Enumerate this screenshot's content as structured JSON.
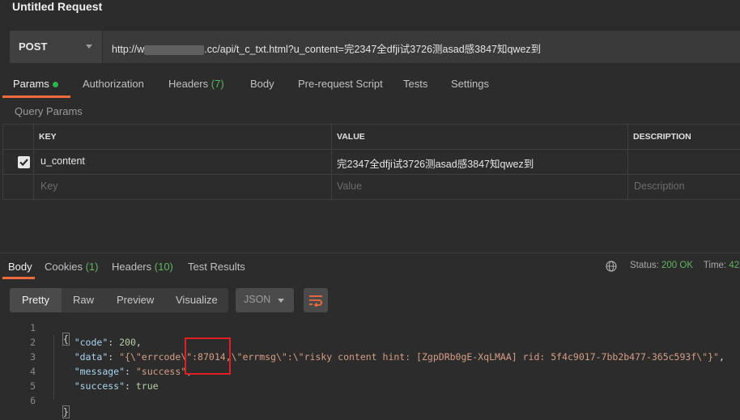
{
  "window": {
    "title": "Untitled Request"
  },
  "request": {
    "method": "POST",
    "url_prefix": "http://w",
    "url_suffix": ".cc/api/t_c_txt.html?u_content=完2347全dfji试3726测asad感3847知qwez到"
  },
  "tabs": {
    "params": "Params",
    "authorization": "Authorization",
    "headers": "Headers",
    "headers_count": "(7)",
    "body": "Body",
    "prerequest": "Pre-request Script",
    "tests": "Tests",
    "settings": "Settings"
  },
  "query_params": {
    "section_label": "Query Params",
    "columns": {
      "key": "KEY",
      "value": "VALUE",
      "description": "DESCRIPTION"
    },
    "rows": [
      {
        "checked": true,
        "key": "u_content",
        "value": "完2347全dfji试3726测asad感3847知qwez到",
        "description": ""
      }
    ],
    "placeholders": {
      "key": "Key",
      "value": "Value",
      "description": "Description"
    }
  },
  "response": {
    "tabs": {
      "body": "Body",
      "cookies": "Cookies",
      "cookies_count": "(1)",
      "headers": "Headers",
      "headers_count": "(10)",
      "test_results": "Test Results"
    },
    "status_label": "Status:",
    "status_value": "200 OK",
    "time_label": "Time:",
    "time_value": "42",
    "formats": [
      "Pretty",
      "Raw",
      "Preview",
      "Visualize"
    ],
    "language": "JSON",
    "line_numbers": [
      "1",
      "2",
      "3",
      "4",
      "5",
      "6"
    ],
    "json": {
      "open": "{",
      "close": "}",
      "code_key": "\"code\"",
      "code_val": "200",
      "data_key": "\"data\"",
      "data_val_a": "\"{\\\"errcode\\\"",
      "data_val_b": ":87014,",
      "data_val_c": "\\\"errmsg\\\":\\\"risky content hint: [ZgpDRb0gE-XqLMAA] rid: 5f4c9017-7bb2b477-365c593f\\\"}\"",
      "message_key": "\"message\"",
      "message_val": "\"success\"",
      "success_key": "\"success\"",
      "success_val": "true"
    }
  },
  "colors": {
    "accent": "#f26b3a",
    "status_ok": "#5fb560",
    "highlight_box": "#e02020"
  }
}
